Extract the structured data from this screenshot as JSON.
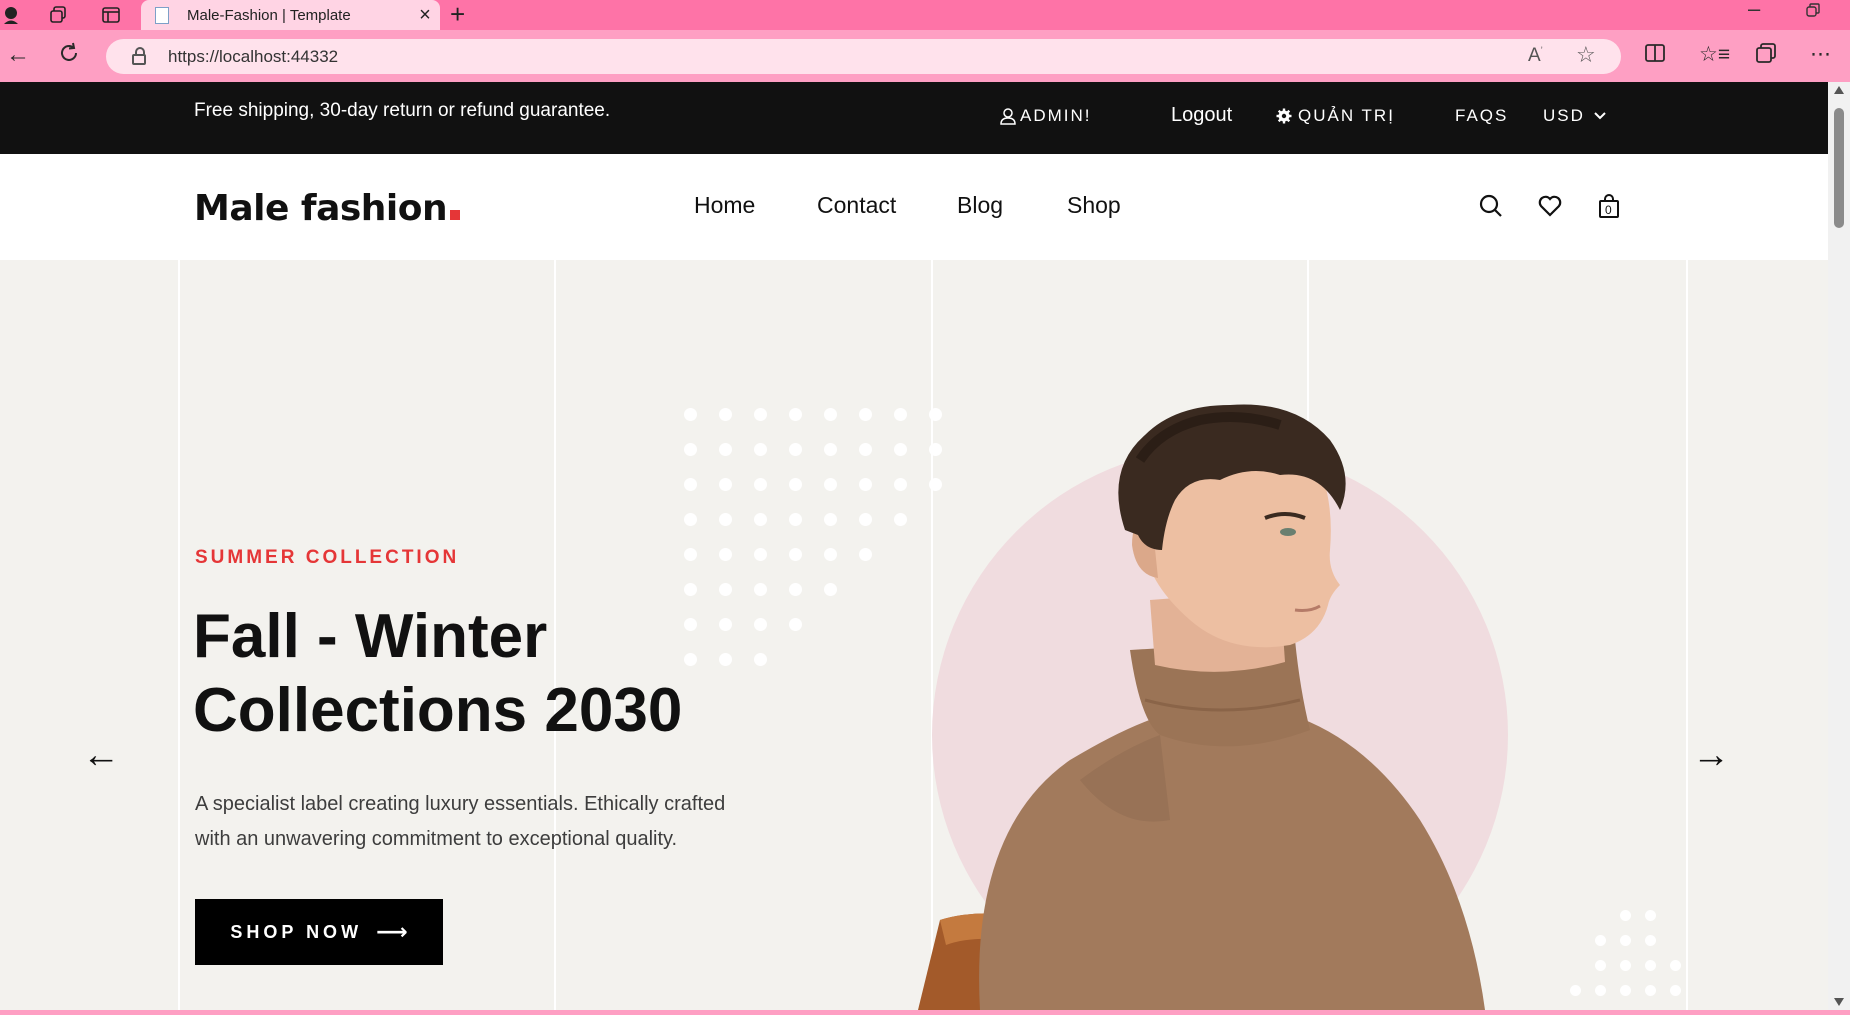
{
  "browser": {
    "tab_title": "Male-Fashion | Template",
    "url": "https://localhost:44332",
    "tab_close": "×",
    "new_tab": "+"
  },
  "topbar": {
    "promo": "Free shipping, 30-day return or refund guarantee.",
    "user": "ADMIN!",
    "logout": "Logout",
    "admin": "QUẢN TRỊ",
    "faqs": "FAQS",
    "currency": "USD"
  },
  "header": {
    "logo": "Male fashion",
    "menu": [
      "Home",
      "Contact",
      "Blog",
      "Shop"
    ],
    "cart_count": "0"
  },
  "hero": {
    "subtitle": "SUMMER COLLECTION",
    "title_line1": "Fall - Winter",
    "title_line2": "Collections 2030",
    "description": "A specialist label creating luxury essentials. Ethically crafted with an unwavering commitment to exceptional quality.",
    "button_label": "SHOP NOW",
    "prev_arrow": "←",
    "next_arrow": "→"
  },
  "colors": {
    "accent": "#e53637",
    "topbar_bg": "#111111",
    "hero_bg": "#f3f2ee",
    "browser_chrome": "#fe73a7",
    "hero_circle": "#f0dcdf",
    "sweater": "#a27a5c"
  },
  "icons": {
    "search": "search-icon",
    "wishlist": "heart-icon",
    "cart": "shopping-bag-icon",
    "user": "user-icon",
    "settings": "gear-icon",
    "currency_dropdown": "chevron-down-icon"
  }
}
